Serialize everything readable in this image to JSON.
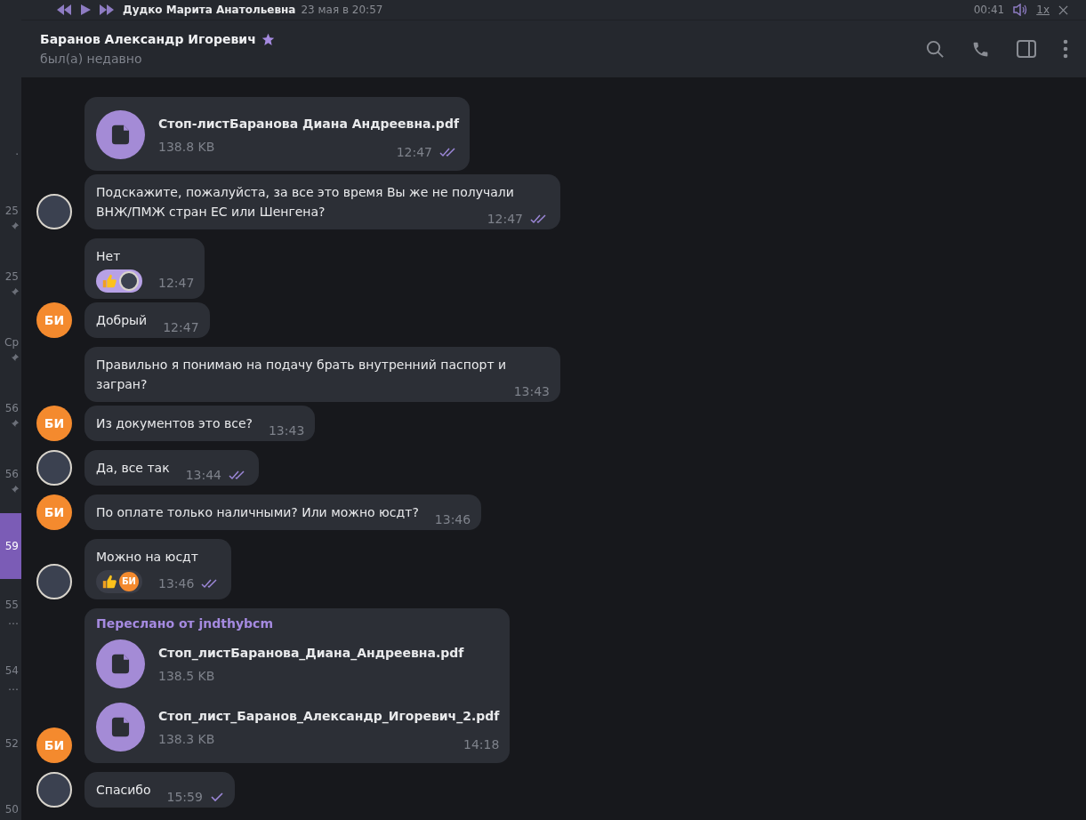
{
  "sidebar": {
    "items": [
      {
        "time": ".",
        "pinned": false,
        "selected": false
      },
      {
        "time": "25",
        "pinned": true,
        "selected": false
      },
      {
        "time": "25",
        "pinned": true,
        "selected": false
      },
      {
        "time": "Ср",
        "pinned": true,
        "selected": false
      },
      {
        "time": "56",
        "pinned": true,
        "selected": false
      },
      {
        "time": "56",
        "pinned": true,
        "selected": false
      },
      {
        "time": "59",
        "pinned": false,
        "selected": true
      },
      {
        "time": "55",
        "preview": "…",
        "pinned": false,
        "selected": false
      },
      {
        "time": "54",
        "preview": "…",
        "pinned": false,
        "selected": false
      },
      {
        "time": "52",
        "pinned": false,
        "selected": false
      },
      {
        "time": "50",
        "pinned": false,
        "selected": false
      }
    ]
  },
  "player": {
    "name": "Дудко Марита Анатольевна",
    "date": "23 мая в 20:57",
    "time": "00:41",
    "speed": "1x"
  },
  "header": {
    "title": "Баранов Александр Игоревич",
    "status": "был(а) недавно"
  },
  "messages": [
    {
      "files": [
        {
          "name": "Стоп-листБаранова Диана Андреевна.pdf",
          "size": "138.8 KB"
        }
      ],
      "time": "12:47",
      "outgoing": true,
      "read": true
    },
    {
      "avatar": {
        "kind": "photo"
      },
      "text": "Подскажите, пожалуйста, за все это время Вы же не получали ВНЖ/ПМЖ стран ЕС или Шенгена?",
      "time": "12:47",
      "outgoing": true,
      "read": true
    },
    {
      "text": "Нет",
      "reactions": [
        {
          "selected": true,
          "reactor": {
            "kind": "photo"
          }
        }
      ],
      "time": "12:47",
      "outgoing": false
    },
    {
      "avatar": {
        "kind": "initials",
        "text": "БИ"
      },
      "text": "Добрый",
      "time": "12:47",
      "outgoing": false
    },
    {
      "text": "Правильно я понимаю на подачу брать внутренний паспорт и загран?",
      "time": "13:43",
      "outgoing": false
    },
    {
      "avatar": {
        "kind": "initials",
        "text": "БИ"
      },
      "text": "Из документов это все?",
      "time": "13:43",
      "outgoing": false
    },
    {
      "avatar": {
        "kind": "photo"
      },
      "text": "Да, все так",
      "time": "13:44",
      "outgoing": true,
      "read": true
    },
    {
      "avatar": {
        "kind": "initials",
        "text": "БИ"
      },
      "text": "По оплате только наличными? Или можно юсдт?",
      "time": "13:46",
      "outgoing": false
    },
    {
      "avatar": {
        "kind": "photo"
      },
      "text": "Можно на юсдт",
      "reactions": [
        {
          "selected": false,
          "reactor": {
            "kind": "initials",
            "text": "БИ"
          }
        }
      ],
      "time": "13:46",
      "outgoing": true,
      "read": true
    },
    {
      "avatar": {
        "kind": "initials",
        "text": "БИ"
      },
      "forwarded": "Переслано от jndthybcm",
      "files": [
        {
          "name": "Стоп_листБаранова_Диана_Андреевна.pdf",
          "size": "138.5 KB"
        },
        {
          "name": "Стоп_лист_Баранов_Александр_Игоревич_2.pdf",
          "size": "138.3 KB"
        }
      ],
      "time": "14:18",
      "outgoing": false
    },
    {
      "avatar": {
        "kind": "photo"
      },
      "text": "Спасибо",
      "time": "15:59",
      "outgoing": true,
      "read": false
    }
  ]
}
